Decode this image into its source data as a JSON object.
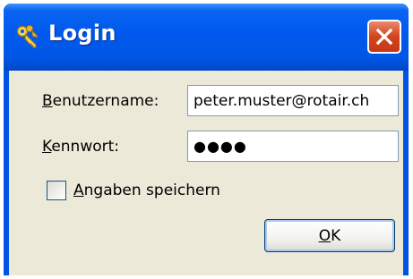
{
  "window": {
    "title": "Login",
    "title_icon": "keys-icon",
    "close_icon": "close-icon"
  },
  "form": {
    "username": {
      "label_mnemonic": "B",
      "label_rest": "enutzername:",
      "value": "peter.muster@rotair.ch"
    },
    "password": {
      "label_mnemonic": "K",
      "label_rest": "ennwort:",
      "masked_value": "●●●●"
    },
    "remember": {
      "label_mnemonic": "A",
      "label_rest": "ngaben speichern",
      "checked": false
    },
    "ok_button": {
      "label_mnemonic": "O",
      "label_rest": "K"
    }
  },
  "colors": {
    "titlebar": "#0058ee",
    "client_background": "#ece9d8",
    "close_button": "#d2441b",
    "field_border": "#7f9db9"
  }
}
